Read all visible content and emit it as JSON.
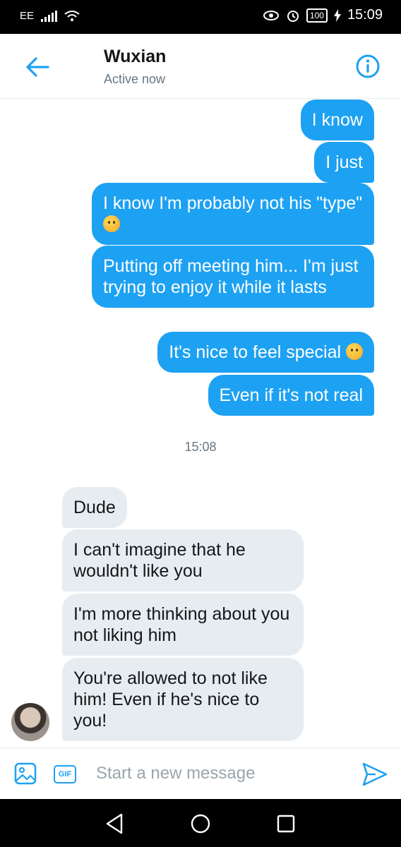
{
  "status_bar": {
    "carrier": "EE",
    "battery": "100",
    "time": "15:09"
  },
  "header": {
    "contact_name": "Wuxian",
    "contact_status": "Active now"
  },
  "messages": {
    "outgoing": [
      {
        "text": "I know"
      },
      {
        "text": "I just"
      },
      {
        "text": "I know I'm probably not his \"type\"",
        "emoji": "crying-face"
      },
      {
        "text": "Putting off meeting him... I'm just trying to enjoy it while it lasts"
      },
      {
        "text": "It's nice to feel special",
        "emoji": "weary-face"
      },
      {
        "text": "Even if it's not real"
      }
    ],
    "timestamp": "15:08",
    "incoming": [
      {
        "text": "Dude"
      },
      {
        "text": "I can't imagine that he wouldn't like you"
      },
      {
        "text": "I'm more thinking about you not liking him"
      },
      {
        "text": "You're allowed to not like him! Even if he's nice to you!"
      }
    ]
  },
  "composer": {
    "placeholder": "Start a new message",
    "gif_label": "GIF"
  },
  "colors": {
    "accent": "#1da1f2",
    "incoming_bubble": "#e6ecf0",
    "status_bar": "#000000"
  }
}
